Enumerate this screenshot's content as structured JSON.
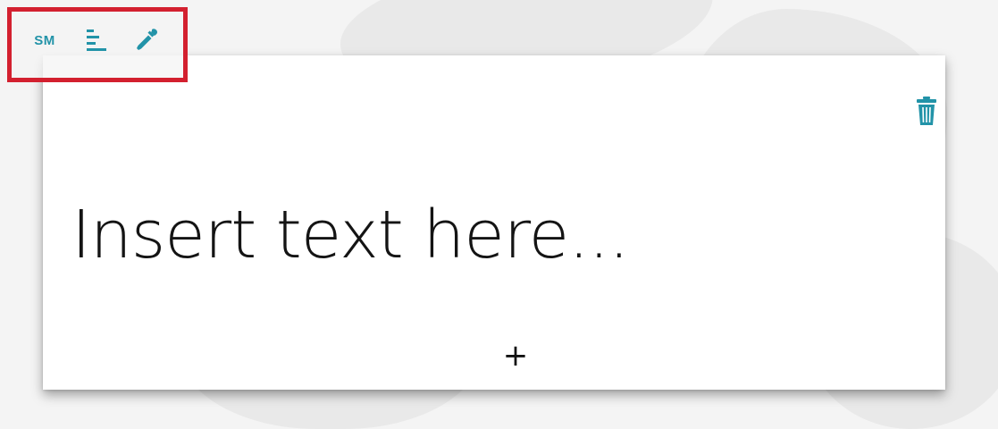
{
  "toolbar": {
    "size_label": "SM",
    "align_icon": "align-left-icon",
    "color_icon": "eyedropper-icon"
  },
  "card": {
    "delete_icon": "trash-icon",
    "text": "Insert text here...",
    "add_label": "+"
  },
  "colors": {
    "accent": "#2293a8",
    "highlight_border": "#d3202f",
    "text": "#141414",
    "card_background": "#ffffff",
    "page_background": "#f4f4f4"
  }
}
